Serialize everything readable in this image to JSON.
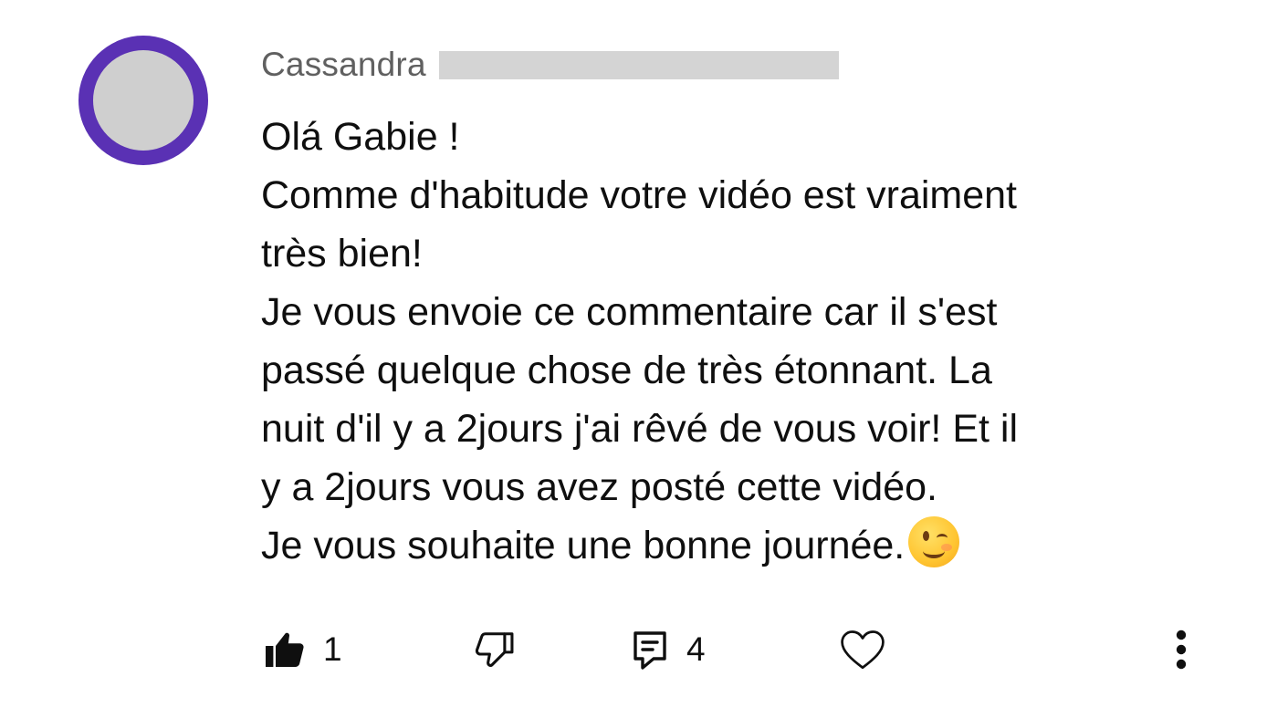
{
  "comment": {
    "author": "Cassandra",
    "lines": [
      "Olá Gabie !",
      "Comme d'habitude votre vidéo est vraiment",
      "très bien!",
      "Je vous envoie ce commentaire car il s'est",
      "passé quelque chose de très étonnant. La",
      "nuit d'il y a 2jours j'ai rêvé de vous voir! Et il",
      "y a 2jours vous avez posté cette vidéo.",
      "Je vous souhaite une bonne journée."
    ],
    "trailing_emoji": "winking-face-emoji"
  },
  "actions": {
    "like_count": "1",
    "reply_count": "4",
    "like_icon": "thumbs-up-filled-icon",
    "dislike_icon": "thumbs-down-outline-icon",
    "reply_icon": "reply-comment-icon",
    "heart_icon": "heart-outline-icon",
    "more_icon": "more-vertical-icon"
  },
  "colors": {
    "avatar_ring": "#5a31b4",
    "avatar_fill": "#cfcfcf",
    "author_text": "#606060",
    "body_text": "#0f0f0f"
  }
}
